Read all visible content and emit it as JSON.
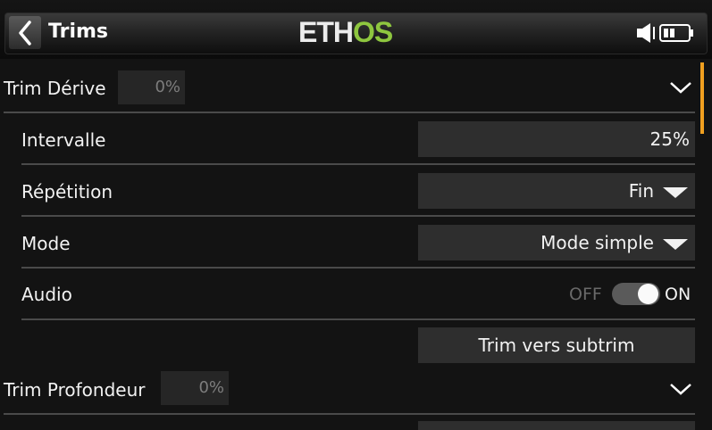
{
  "header": {
    "title": "Trims",
    "logo_left": "ETH",
    "logo_right": "OS",
    "back_icon": "chevron-left-icon",
    "speaker_icon": "speaker-icon",
    "battery_icon": "battery-icon"
  },
  "sections": [
    {
      "label": "Trim Dérive",
      "value": "0%",
      "expander_icon": "chevron-down-icon"
    },
    {
      "label": "Trim Profondeur",
      "value": "0%",
      "expander_icon": "chevron-down-icon"
    }
  ],
  "settings": {
    "interval": {
      "label": "Intervalle",
      "value": "25%"
    },
    "repeat": {
      "label": "Répétition",
      "value": "Fin"
    },
    "mode": {
      "label": "Mode",
      "value": "Mode simple"
    },
    "audio": {
      "label": "Audio",
      "off_label": "OFF",
      "on_label": "ON",
      "state": true
    },
    "subtrim_button": "Trim vers subtrim"
  },
  "colors": {
    "accent": "#8ec63f",
    "scroll_indicator": "#f0a020",
    "background": "#131313"
  }
}
